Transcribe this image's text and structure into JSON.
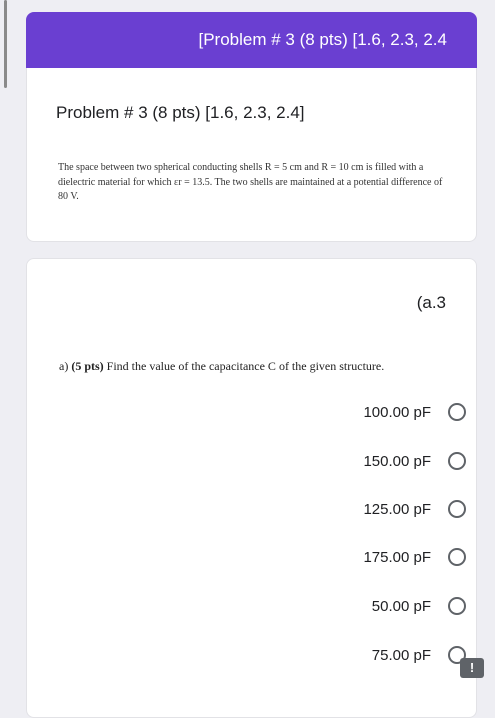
{
  "header": {
    "title": "[Problem # 3 (8 pts) [1.6, 2.3, 2.4"
  },
  "section": {
    "title": "Problem # 3 (8 pts) [1.6, 2.3, 2.4]",
    "description": "The space between two spherical conducting shells R = 5 cm and R = 10 cm is filled with a dielectric material for which εr = 13.5. The two shells are maintained at a potential difference of 80 V."
  },
  "question": {
    "tag": "(a.3",
    "prefix": "a)",
    "points": "(5 pts)",
    "text": "Find the value of the capacitance C of the given structure.",
    "options": [
      "100.00 pF",
      "150.00 pF",
      "125.00 pF",
      "175.00 pF",
      "50.00 pF",
      "75.00 pF"
    ]
  },
  "report_icon": "exclamation-icon",
  "colors": {
    "header": "#6a3fd1",
    "background": "#eeeef3",
    "radio": "#5f6368"
  }
}
